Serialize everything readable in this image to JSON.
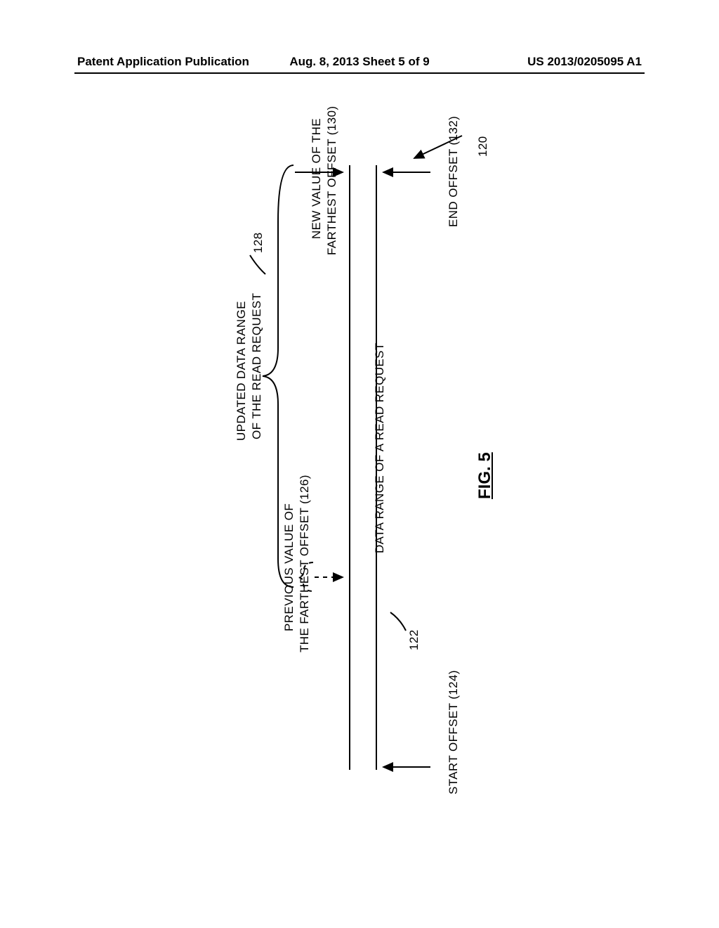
{
  "header": {
    "left": "Patent Application Publication",
    "center": "Aug. 8, 2013  Sheet 5 of 9",
    "right": "US 2013/0205095 A1"
  },
  "fig": {
    "caption": "FIG. 5",
    "ref_120": "120",
    "ref_128": "128",
    "ref_122": "122",
    "updated_range_l1": "UPDATED DATA RANGE",
    "updated_range_l2": "OF THE READ REQUEST",
    "new_value_l1": "NEW VALUE OF THE",
    "new_value_l2": "FARTHEST OFFSET  (130)",
    "end_offset": "END OFFSET  (132)",
    "prev_value_l1": "PREVIOUS VALUE OF",
    "prev_value_l2": "THE FARTHEST OFFSET  (126)",
    "data_range": "DATA RANGE OF A READ REQUEST",
    "start_offset": "START OFFSET (124)"
  }
}
